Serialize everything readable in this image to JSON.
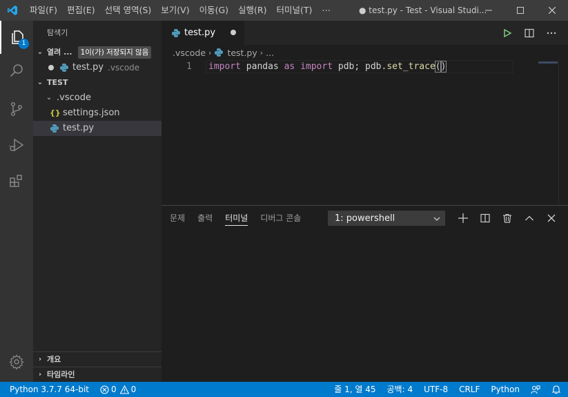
{
  "titlebar": {
    "menu": [
      "파일(F)",
      "편집(E)",
      "선택 영역(S)",
      "보기(V)",
      "이동(G)",
      "실행(R)",
      "터미널(T)",
      "⋯"
    ],
    "title": "● test.py - Test - Visual Studi..."
  },
  "activitybar": {
    "explorer_badge": "1"
  },
  "sidebar": {
    "title": "탐색기",
    "open_editors": {
      "label": "열려 ...",
      "badge": "1이(가) 저장되지 않음",
      "file": "test.py",
      "file_dir": ".vscode"
    },
    "workspace": {
      "label": "TEST",
      "folder": ".vscode",
      "files": [
        "settings.json",
        "test.py"
      ]
    },
    "outline_label": "개요",
    "timeline_label": "타임라인"
  },
  "editor": {
    "tab_label": "test.py",
    "breadcrumb": {
      "folder": ".vscode",
      "file": "test.py",
      "more": "..."
    },
    "line_number": "1",
    "code": {
      "kw1": "import",
      "t1": " pandas ",
      "kw2": "as",
      "t2": " ",
      "kw3": "import",
      "t3": " pdb; pdb.",
      "fn": "set_trace",
      "br_open": "(",
      "br_close": ")"
    }
  },
  "panel": {
    "tabs": [
      "문제",
      "출력",
      "터미널",
      "디버그 콘솔"
    ],
    "active_tab": "터미널",
    "terminal_select": "1: powershell"
  },
  "statusbar": {
    "interpreter": "Python 3.7.7 64-bit",
    "errors": "0",
    "warnings": "0",
    "position": "줄 1, 열 45",
    "spaces": "공백: 4",
    "encoding": "UTF-8",
    "eol": "CRLF",
    "language": "Python"
  },
  "colors": {
    "accent": "#007acc",
    "keyword": "#c586c0",
    "function": "#dcdcaa",
    "python_icon": "#519aba",
    "json_icon": "#cbcb41"
  }
}
